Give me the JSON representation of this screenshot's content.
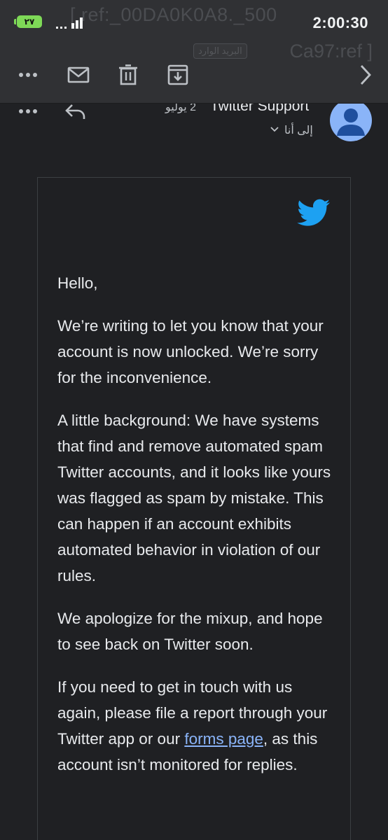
{
  "status_bar": {
    "battery_text": "٢٧",
    "time": "2:00:30",
    "ghost_subject_line1": "[ ref:_00DA0K0A8._500",
    "ghost_subject_line2": "Ca97:ref ]",
    "ghost_chip": "البريد الوارد"
  },
  "toolbar": {
    "more_icon": "more-horizontal-icon",
    "mark_unread_icon": "mail-icon",
    "delete_icon": "trash-icon",
    "archive_icon": "archive-icon",
    "next_icon": "chevron-right-icon"
  },
  "message": {
    "sender": "Twitter Support",
    "date": "2 يوليو",
    "recipient": "إلى أنا",
    "avatar_color": "#8ab4f8"
  },
  "email": {
    "greeting": "Hello,",
    "p1": "We’re writing to let you know that your account is now unlocked. We’re sorry for the inconvenience.",
    "p2": "A little background: We have systems that find and remove automated spam Twitter accounts, and it looks like yours was flagged as spam by mistake. This can happen if an account exhibits automated behavior in violation of our rules.",
    "p3": "We apologize for the mixup, and hope to see back on Twitter soon.",
    "p4_before": "If you need to get in touch with us again, please file a report through your Twitter app or our ",
    "p4_link": "forms page",
    "p4_after": ", as this account isn’t monitored for replies.",
    "brand_color": "#1da1f2",
    "link_color": "#8ab4f8"
  }
}
